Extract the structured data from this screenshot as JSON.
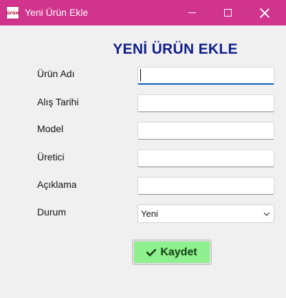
{
  "window": {
    "title": "Yeni Ürün Ekle",
    "app_icon_text": "ürün"
  },
  "form": {
    "heading": "YENİ ÜRÜN EKLE",
    "fields": [
      {
        "label": "Ürün Adı",
        "value": "",
        "focused": true
      },
      {
        "label": "Alış Tarihi",
        "value": ""
      },
      {
        "label": "Model",
        "value": ""
      },
      {
        "label": "Üretici",
        "value": ""
      },
      {
        "label": "Açıklama",
        "value": ""
      }
    ],
    "status": {
      "label": "Durum",
      "selected": "Yeni"
    },
    "save_button": {
      "label": "Kaydet",
      "icon": "checkmark-icon"
    }
  },
  "colors": {
    "titlebar": "#d1348d",
    "heading": "#0f1d8a",
    "save_button_bg": "#8ef08e",
    "focus_underline": "#0a5fb4"
  }
}
